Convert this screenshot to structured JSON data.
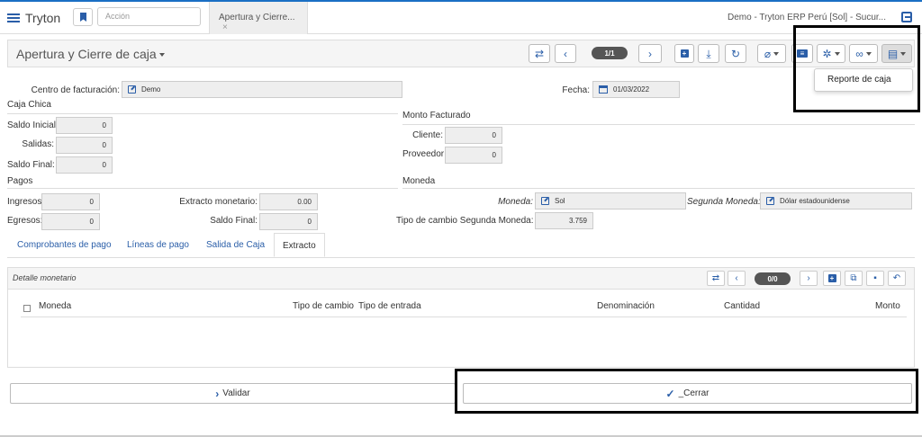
{
  "topbar": {
    "brand": "Tryton",
    "search_placeholder": "Acción",
    "tab_label": "Apertura y Cierre...",
    "tab_close": "×",
    "company": "Demo - Tryton ERP Perú [Sol] - Sucur..."
  },
  "header": {
    "title": "Apertura y Cierre de caja",
    "pager": "1/1"
  },
  "print_menu": {
    "item": "Reporte de caja"
  },
  "form": {
    "centro_label": "Centro de facturación:",
    "centro_value": "Demo",
    "fecha_label": "Fecha:",
    "fecha_value": "01/03/2022",
    "caja_chica": "Caja Chica",
    "saldo_inicial_label": "Saldo Inicial:",
    "saldo_inicial": "0",
    "salidas_label": "Salidas:",
    "salidas": "0",
    "saldo_final_label": "Saldo Final:",
    "saldo_final": "0",
    "monto_facturado": "Monto Facturado",
    "cliente_label": "Cliente:",
    "cliente": "0",
    "proveedor_label": "Proveedor:",
    "proveedor": "0",
    "pagos": "Pagos",
    "ingresos_label": "Ingresos:",
    "ingresos": "0",
    "egresos_label": "Egresos:",
    "egresos": "0",
    "extracto_label": "Extracto monetario:",
    "extracto": "0.00",
    "saldo_final2_label": "Saldo Final:",
    "saldo_final2": "0",
    "moneda_section": "Moneda",
    "moneda_label": "Moneda:",
    "moneda_value": "Sol",
    "segunda_label": "Segunda Moneda:",
    "segunda_value": "Dólar estadounidense",
    "tipo_cambio_label": "Tipo de cambio Segunda Moneda:",
    "tipo_cambio": "3.759"
  },
  "tabs": [
    "Comprobantes de pago",
    "Líneas de pago",
    "Salida de Caja",
    "Extracto"
  ],
  "detalle": {
    "title": "Detalle monetario",
    "pager": "0/0",
    "columns": [
      "Moneda",
      "Tipo de cambio",
      "Tipo de entrada",
      "Denominación",
      "Cantidad",
      "Monto"
    ]
  },
  "buttons": {
    "validar": "Validar",
    "cerrar": "_Cerrar"
  }
}
